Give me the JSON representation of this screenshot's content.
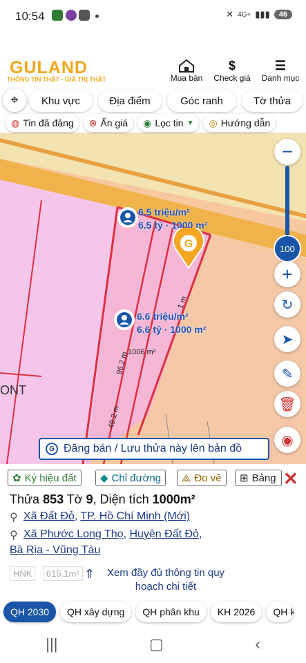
{
  "status": {
    "time": "10:54",
    "network": "4G+",
    "battery": "46"
  },
  "header": {
    "logo": "GULAND",
    "tagline": "THÔNG TIN THẬT - GIÁ TRỊ THẬT",
    "nav": [
      {
        "label": "Mua bán",
        "icon": "house-icon"
      },
      {
        "label": "Check giá",
        "icon": "dollar-icon"
      },
      {
        "label": "Danh mục",
        "icon": "menu-icon"
      }
    ]
  },
  "filters_row1": [
    "Khu vực",
    "Địa điểm",
    "Góc ranh",
    "Tờ thửa"
  ],
  "filters_row2": [
    "Tin đã đăng",
    "Ẩn giá",
    "Lọc tin",
    "Hướng dẫn"
  ],
  "map": {
    "zoom": "100",
    "zoom_level_fraction": 0.6,
    "listing1": {
      "price_per_m2": "6.5 triệu/m²",
      "total": "6.5 tỷ · 1000 m²"
    },
    "listing2": {
      "price_per_m2": "6.6 triệu/m²",
      "total": "6.6 tỷ · 1000 m²"
    },
    "labels": {
      "area": "1006 m²",
      "edge1": "96.2 m",
      "edge2": "49.2 m",
      "edge3": "1 m",
      "zone": "ONT"
    },
    "save_banner": "Đăng bán / Lưu thửa này lên bản đồ"
  },
  "panel": {
    "tabs": [
      "Ký hiệu đất",
      "Chỉ đường",
      "Đo vẽ",
      "Bảng"
    ],
    "parcel_prefix": "Thửa ",
    "parcel_no": "853",
    "sheet_prefix": " Tờ ",
    "sheet_no": "9",
    "area_prefix": ", Diện tích ",
    "area": "1000m²",
    "addr1_a": "Xã Đất Đỏ",
    "addr1_b": "TP. Hồ Chí Minh (Mới)",
    "addr2_a": "Xã Phước Long Thọ",
    "addr2_b": "Huyện Đất Đỏ",
    "addr2_c": "Bà Rịa - Vũng Tàu",
    "hnk": "HNK",
    "hnk_val": "615.1m²",
    "more": "Xem đầy đủ thông tin quy hoạch chi tiết"
  },
  "bottom_tabs": [
    "QH 2030",
    "QH xây dựng",
    "QH phân khu",
    "KH 2026",
    "QH k"
  ],
  "colors": {
    "accent": "#f0a81c",
    "blue": "#1a56a8",
    "pink": "#f6b6d6",
    "orange": "#f7c8a0"
  }
}
